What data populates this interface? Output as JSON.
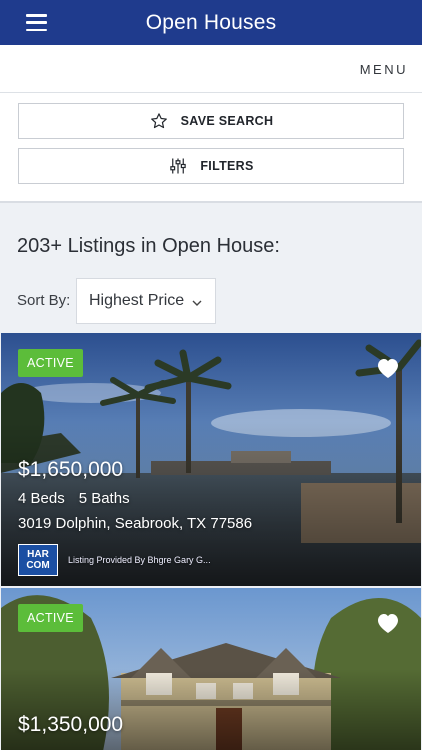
{
  "header": {
    "title": "Open Houses",
    "menu_icon": "hamburger-icon"
  },
  "subheader": {
    "menu_label": "MENU"
  },
  "actions": {
    "save_search_label": "SAVE SEARCH",
    "save_search_icon": "star-outline-icon",
    "filters_label": "FILTERS",
    "filters_icon": "sliders-icon"
  },
  "listings": {
    "heading": "203+ Listings in Open House:",
    "sort_label": "Sort By:",
    "sort_value": "Highest Price"
  },
  "cards": [
    {
      "status": "ACTIVE",
      "price": "$1,650,000",
      "beds": "4 Beds",
      "baths": "5 Baths",
      "address": "3019 Dolphin, Seabrook, TX 77586",
      "provider": "Listing Provided By Bhgre Gary G...",
      "logo_top": "HAR",
      "logo_bottom": "COM",
      "favorite_icon": "heart-icon"
    },
    {
      "status": "ACTIVE",
      "price": "$1,350,000",
      "favorite_icon": "heart-icon"
    }
  ],
  "colors": {
    "header_bg": "#1f3b8d",
    "status_active": "#5cbd3a"
  }
}
